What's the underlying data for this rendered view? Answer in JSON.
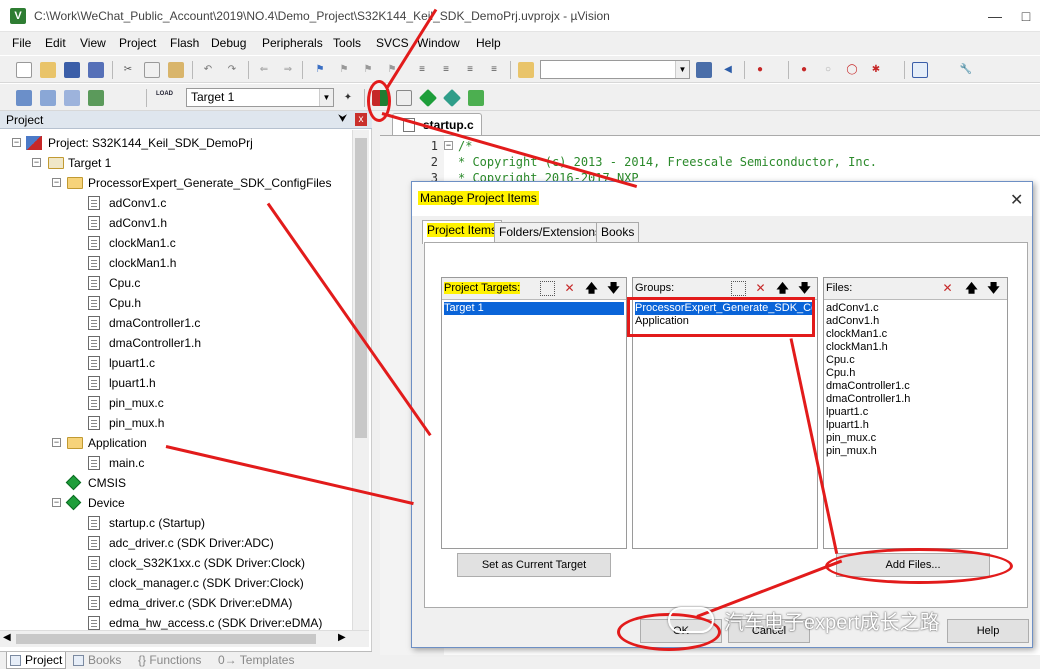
{
  "window": {
    "title": "C:\\Work\\WeChat_Public_Account\\2019\\NO.4\\Demo_Project\\S32K144_Keil_SDK_DemoPrj.uvprojx - µVision",
    "app_icon": "V"
  },
  "menu": [
    "File",
    "Edit",
    "View",
    "Project",
    "Flash",
    "Debug",
    "Peripherals",
    "Tools",
    "SVCS",
    "Window",
    "Help"
  ],
  "build_toolbar": {
    "target_select": "Target 1",
    "load_icon_text": "LOAD"
  },
  "project_panel": {
    "title": "Project",
    "pin": "⮟",
    "close": "x",
    "root": "Project: S32K144_Keil_SDK_DemoPrj",
    "target": "Target 1",
    "group1": {
      "name": "ProcessorExpert_Generate_SDK_ConfigFiles",
      "files": [
        "adConv1.c",
        "adConv1.h",
        "clockMan1.c",
        "clockMan1.h",
        "Cpu.c",
        "Cpu.h",
        "dmaController1.c",
        "dmaController1.h",
        "lpuart1.c",
        "lpuart1.h",
        "pin_mux.c",
        "pin_mux.h"
      ]
    },
    "group2": {
      "name": "Application",
      "files": [
        "main.c"
      ]
    },
    "cmsis": "CMSIS",
    "device": {
      "name": "Device",
      "files": [
        "startup.c (Startup)",
        "adc_driver.c (SDK Driver:ADC)",
        "clock_S32K1xx.c (SDK Driver:Clock)",
        "clock_manager.c (SDK Driver:Clock)",
        "edma_driver.c (SDK Driver:eDMA)",
        "edma_hw_access.c (SDK Driver:eDMA)"
      ]
    }
  },
  "bottom_tabs": [
    "Project",
    "Books",
    "{} Functions",
    "0→ Templates"
  ],
  "editor": {
    "tab": "startup.c",
    "lines": [
      {
        "n": "1",
        "text": "/*"
      },
      {
        "n": "2",
        "text": " * Copyright (c) 2013 - 2014, Freescale Semiconductor, Inc."
      },
      {
        "n": "3",
        "text": " * Copyright 2016-2017 NXP"
      }
    ]
  },
  "dialog": {
    "title": "Manage Project Items",
    "close": "✕",
    "tabs": [
      "Project Items",
      "Folders/Extensions",
      "Books"
    ],
    "targets": {
      "label": "Project Targets:",
      "items": [
        "Target 1"
      ]
    },
    "groups": {
      "label": "Groups:",
      "items": [
        "ProcessorExpert_Generate_SDK_Con",
        "Application"
      ]
    },
    "files": {
      "label": "Files:",
      "items": [
        "adConv1.c",
        "adConv1.h",
        "clockMan1.c",
        "clockMan1.h",
        "Cpu.c",
        "Cpu.h",
        "dmaController1.c",
        "dmaController1.h",
        "lpuart1.c",
        "lpuart1.h",
        "pin_mux.c",
        "pin_mux.h"
      ]
    },
    "set_current_target": "Set as Current Target",
    "add_files": "Add Files...",
    "ok": "OK",
    "cancel": "Cancel",
    "help": "Help"
  },
  "watermark": "汽车电子expert成长之路",
  "colors": {
    "highlight_yellow": "#fff200",
    "annotation_red": "#e21b1b",
    "selection_blue": "#0a64d8",
    "code_green": "#2b8a2b"
  }
}
